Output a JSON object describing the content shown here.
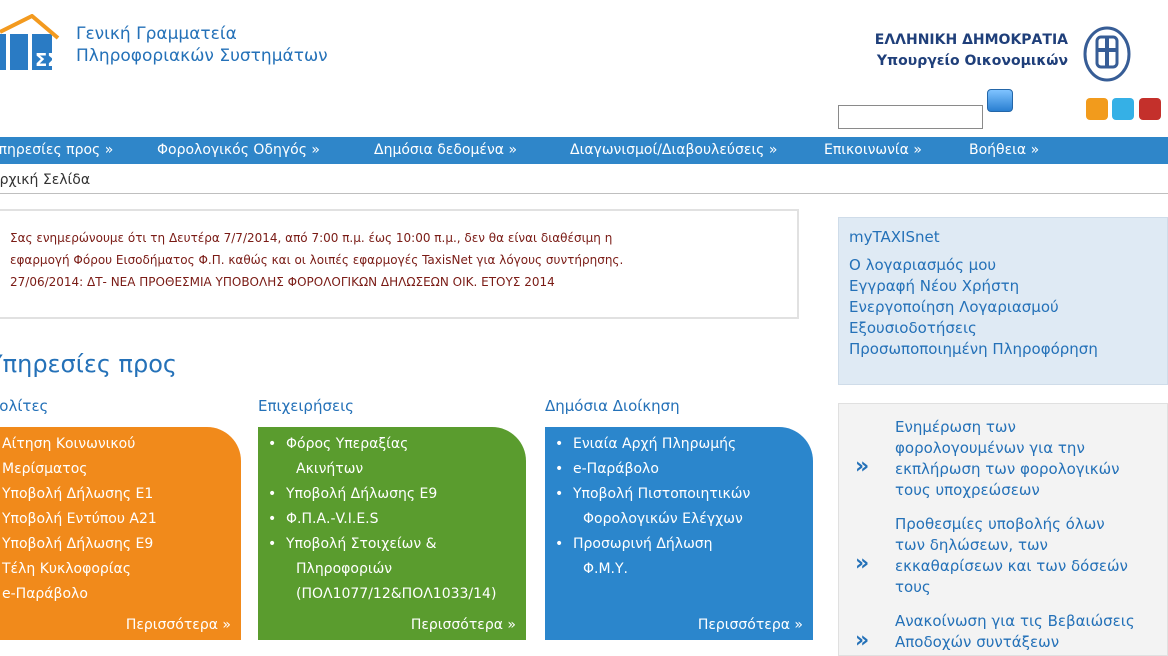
{
  "header": {
    "org_line1": "Γενική Γραμματεία",
    "org_line2": "Πληροφοριακών Συστημάτων",
    "gov_line1": "ΕΛΛΗΝΙΚΗ ΔΗΜΟΚΡΑΤΙΑ",
    "gov_line2": "Υπουργείο Οικονομικών"
  },
  "icons": {
    "logo": "gsis-logo-icon",
    "crest": "greek-crest-icon",
    "search": "search-icon",
    "rss": "rss-icon",
    "twitter": "twitter-icon",
    "youtube": "youtube-icon"
  },
  "colors": {
    "brand_blue": "#2f86c9",
    "link_blue": "#2471b8",
    "notice_red": "#7a1b15",
    "card_orange": "#f18a1b",
    "card_green": "#5a9c2e",
    "card_blue": "#2b86cc"
  },
  "nav": {
    "items": [
      "Υπηρεσίες προς »",
      "Φορολογικός Οδηγός »",
      "Δημόσια δεδομένα »",
      "Διαγωνισμοί/Διαβουλεύσεις »",
      "Επικοινωνία »",
      "Βοήθεια »"
    ]
  },
  "breadcrumb": "Αρχική Σελίδα",
  "notice": {
    "line1": "Σας ενημερώνουμε ότι τη Δευτέρα 7/7/2014, από 7:00 π.μ. έως 10:00 π.μ., δεν θα είναι διαθέσιμη η",
    "line2": "εφαρμογή Φόρου Εισοδήματος Φ.Π. καθώς και οι λοιπές εφαρμογές TaxisNet για λόγους συντήρησης.",
    "line3": "27/06/2014: ΔΤ- ΝΕΑ ΠΡΟΘΕΣΜΙΑ ΥΠΟΒΟΛΗΣ ΦΟΡΟΛΟΓΙΚΩΝ ΔΗΛΩΣΕΩΝ ΟΙΚ. ΕΤΟΥΣ 2014"
  },
  "services": {
    "title": "Υπηρεσίες προς",
    "more_label": "Περισσότερα »",
    "columns": [
      {
        "title": "Πολίτες",
        "items": [
          "Αίτηση Κοινωνικού",
          "Μερίσματος",
          "Υποβολή Δήλωσης Ε1",
          "Υποβολή Εντύπου Α21",
          "Υποβολή Δήλωσης Ε9",
          "Τέλη Κυκλοφορίας",
          "e-Παράβολο"
        ]
      },
      {
        "title": "Επιχειρήσεις",
        "items": [
          "Φόρος Υπεραξίας",
          "Ακινήτων",
          "Υποβολή Δήλωσης Ε9",
          "Φ.Π.Α.-V.I.E.S",
          "Υποβολή Στοιχείων &",
          "Πληροφοριών",
          "(ΠΟΛ1077/12&ΠΟΛ1033/14)"
        ]
      },
      {
        "title": "Δημόσια Διοίκηση",
        "items": [
          "Ενιαία Αρχή Πληρωμής",
          "e-Παράβολο",
          "Υποβολή Πιστοποιητικών",
          "Φορολογικών Ελέγχων",
          "Προσωρινή Δήλωση",
          "Φ.Μ.Υ."
        ]
      }
    ]
  },
  "mytaxisnet": {
    "title": "myTAXISnet",
    "links": [
      "Ο λογαριασμός μου",
      "Εγγραφή Νέου Χρήστη",
      "Ενεργοποίηση Λογαριασμού",
      "Εξουσιοδοτήσεις",
      "Προσωποποιημένη Πληροφόρηση"
    ]
  },
  "news": {
    "arrow": "»",
    "items": [
      {
        "lines": [
          "Ενημέρωση των",
          "φορολογουμένων για την",
          "εκπλήρωση των φορολογικών",
          "τους υποχρεώσεων"
        ]
      },
      {
        "lines": [
          "Προθεσμίες υποβολής όλων",
          "των δηλώσεων, των",
          "εκκαθαρίσεων και των δόσεών",
          "τους"
        ]
      },
      {
        "lines": [
          "Ανακοίνωση για τις Βεβαιώσεις",
          "Αποδοχών συντάξεων"
        ]
      }
    ]
  }
}
